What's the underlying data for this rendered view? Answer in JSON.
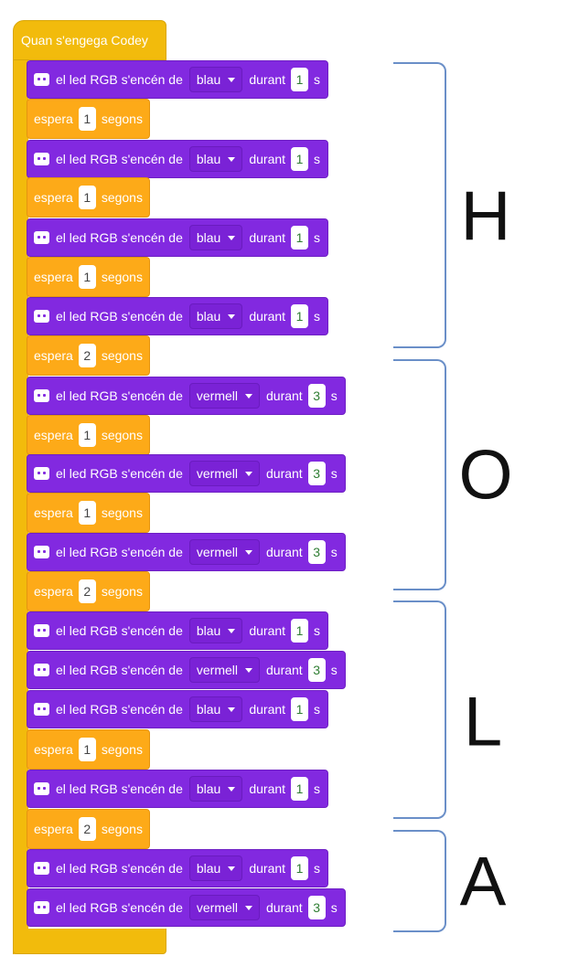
{
  "hat_label": "Quan s'engega Codey",
  "led_text": "el led RGB s'encén de",
  "during_text": "durant",
  "seconds_short": "s",
  "wait_text": "espera",
  "wait_unit": "segons",
  "blocks": [
    {
      "type": "led",
      "color": "blau",
      "value": "1"
    },
    {
      "type": "wait",
      "value": "1"
    },
    {
      "type": "led",
      "color": "blau",
      "value": "1"
    },
    {
      "type": "wait",
      "value": "1"
    },
    {
      "type": "led",
      "color": "blau",
      "value": "1"
    },
    {
      "type": "wait",
      "value": "1"
    },
    {
      "type": "led",
      "color": "blau",
      "value": "1"
    },
    {
      "type": "wait",
      "value": "2"
    },
    {
      "type": "led",
      "color": "vermell",
      "value": "3"
    },
    {
      "type": "wait",
      "value": "1"
    },
    {
      "type": "led",
      "color": "vermell",
      "value": "3"
    },
    {
      "type": "wait",
      "value": "1"
    },
    {
      "type": "led",
      "color": "vermell",
      "value": "3"
    },
    {
      "type": "wait",
      "value": "2"
    },
    {
      "type": "led",
      "color": "blau",
      "value": "1"
    },
    {
      "type": "led",
      "color": "vermell",
      "value": "3"
    },
    {
      "type": "led",
      "color": "blau",
      "value": "1"
    },
    {
      "type": "wait",
      "value": "1"
    },
    {
      "type": "led",
      "color": "blau",
      "value": "1"
    },
    {
      "type": "wait",
      "value": "2"
    },
    {
      "type": "led",
      "color": "blau",
      "value": "1"
    },
    {
      "type": "led",
      "color": "vermell",
      "value": "3"
    }
  ],
  "letters": [
    "H",
    "O",
    "L",
    "A"
  ]
}
